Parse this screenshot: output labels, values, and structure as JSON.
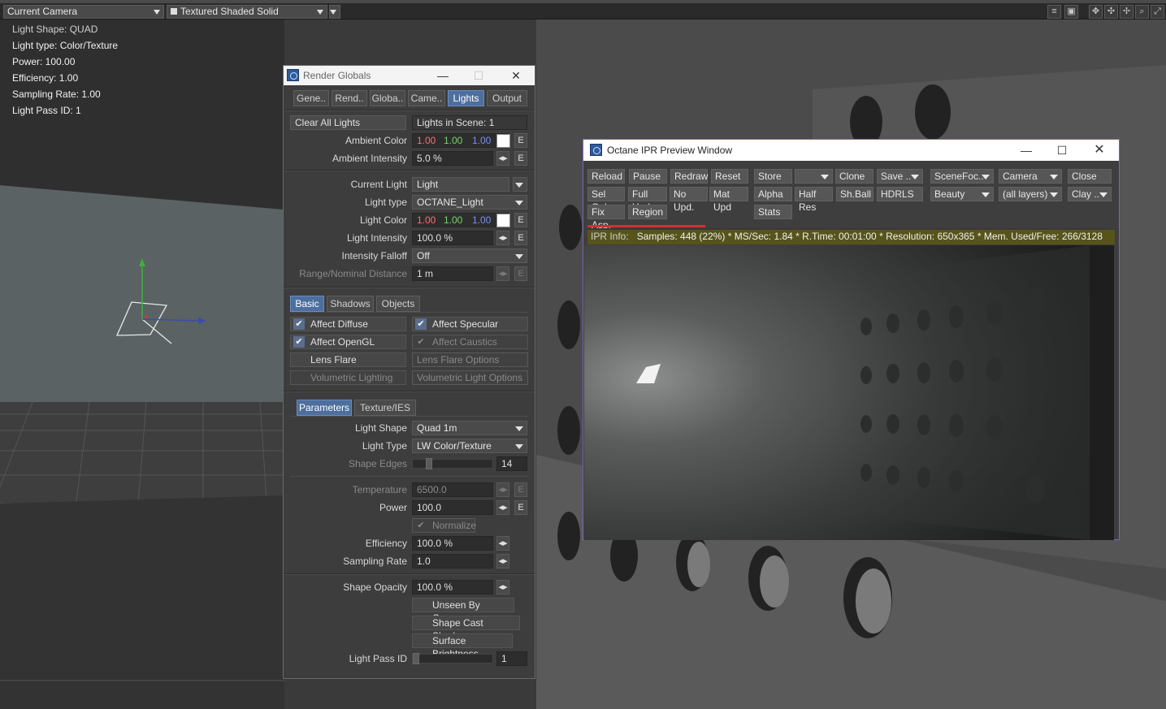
{
  "viewport": {
    "camera_select": "Current Camera",
    "shading_select": "Textured Shaded Solid",
    "info_lines": [
      "Light Shape: QUAD",
      "Light type: Color/Texture",
      "Power: 100.00",
      "Efficiency: 1.00",
      "Sampling Rate: 1.00",
      "Light Pass ID: 1"
    ]
  },
  "render_globals": {
    "title": "Render Globals",
    "tabs": [
      "Gene..",
      "Rend..",
      "Globa..",
      "Came..",
      "Lights",
      "Output"
    ],
    "active_tab": "Lights",
    "clear_all_lights": "Clear All Lights",
    "lights_in_scene": "Lights in Scene: 1",
    "ambient_color_label": "Ambient Color",
    "ambient_color": {
      "r": "1.00",
      "g": "1.00",
      "b": "1.00"
    },
    "ambient_intensity_label": "Ambient Intensity",
    "ambient_intensity": "5.0 %",
    "current_light_label": "Current Light",
    "current_light": "Light",
    "light_type_label": "Light type",
    "light_type": "OCTANE_Light",
    "light_color_label": "Light Color",
    "light_color": {
      "r": "1.00",
      "g": "1.00",
      "b": "1.00"
    },
    "light_intensity_label": "Light Intensity",
    "light_intensity": "100.0 %",
    "intensity_falloff_label": "Intensity Falloff",
    "intensity_falloff": "Off",
    "range_label": "Range/Nominal Distance",
    "range": "1 m",
    "e_label": "E",
    "subtabs": [
      "Basic",
      "Shadows",
      "Objects"
    ],
    "checks": {
      "affect_diffuse": "Affect Diffuse",
      "affect_specular": "Affect Specular",
      "affect_opengl": "Affect OpenGL",
      "affect_caustics": "Affect Caustics",
      "lens_flare": "Lens Flare",
      "lens_flare_options": "Lens Flare Options",
      "volumetric_lighting": "Volumetric Lighting",
      "volumetric_light_options": "Volumetric Light Options"
    },
    "octane_tabs": [
      "Parameters",
      "Texture/IES"
    ],
    "light_shape_label": "Light Shape",
    "light_shape": "Quad 1m",
    "light_type2_label": "Light Type",
    "light_type2": "LW Color/Texture",
    "shape_edges_label": "Shape Edges",
    "shape_edges": "14",
    "temperature_label": "Temperature",
    "temperature": "6500.0",
    "power_label": "Power",
    "power": "100.0",
    "normalize": "Normalize",
    "efficiency_label": "Efficiency",
    "efficiency": "100.0 %",
    "sampling_rate_label": "Sampling Rate",
    "sampling_rate": "1.0",
    "shape_opacity_label": "Shape Opacity",
    "shape_opacity": "100.0 %",
    "unseen_by_camera": "Unseen By Camera",
    "shape_cast_shadow": "Shape Cast Shadow",
    "surface_brightness": "Surface Brightness",
    "light_pass_id_label": "Light Pass ID",
    "light_pass_id": "1"
  },
  "octane": {
    "title": "Octane IPR Preview Window",
    "row1": [
      "Reload",
      "Pause",
      "Redraw",
      "Reset",
      "Store",
      "",
      "Clone",
      "Save ..",
      "SceneFoc..",
      "Camera",
      "Close"
    ],
    "row2": [
      "Sel Only",
      "Full Upd.",
      "No Upd.",
      "Mat Upd",
      "Alpha",
      "Half Res",
      "Sh.Ball",
      "HDRLS",
      "Beauty",
      "(all layers)",
      "Clay .."
    ],
    "row3": [
      "Fix Asp.",
      "Region",
      "Stats"
    ],
    "ipr_info_label": "IPR Info:",
    "ipr_info": "Samples: 448 (22%)  *  MS/Sec: 1.84  *  R.Time: 00:01:00  *  Resolution: 650x365  *  Mem. Used/Free: 266/3128"
  }
}
